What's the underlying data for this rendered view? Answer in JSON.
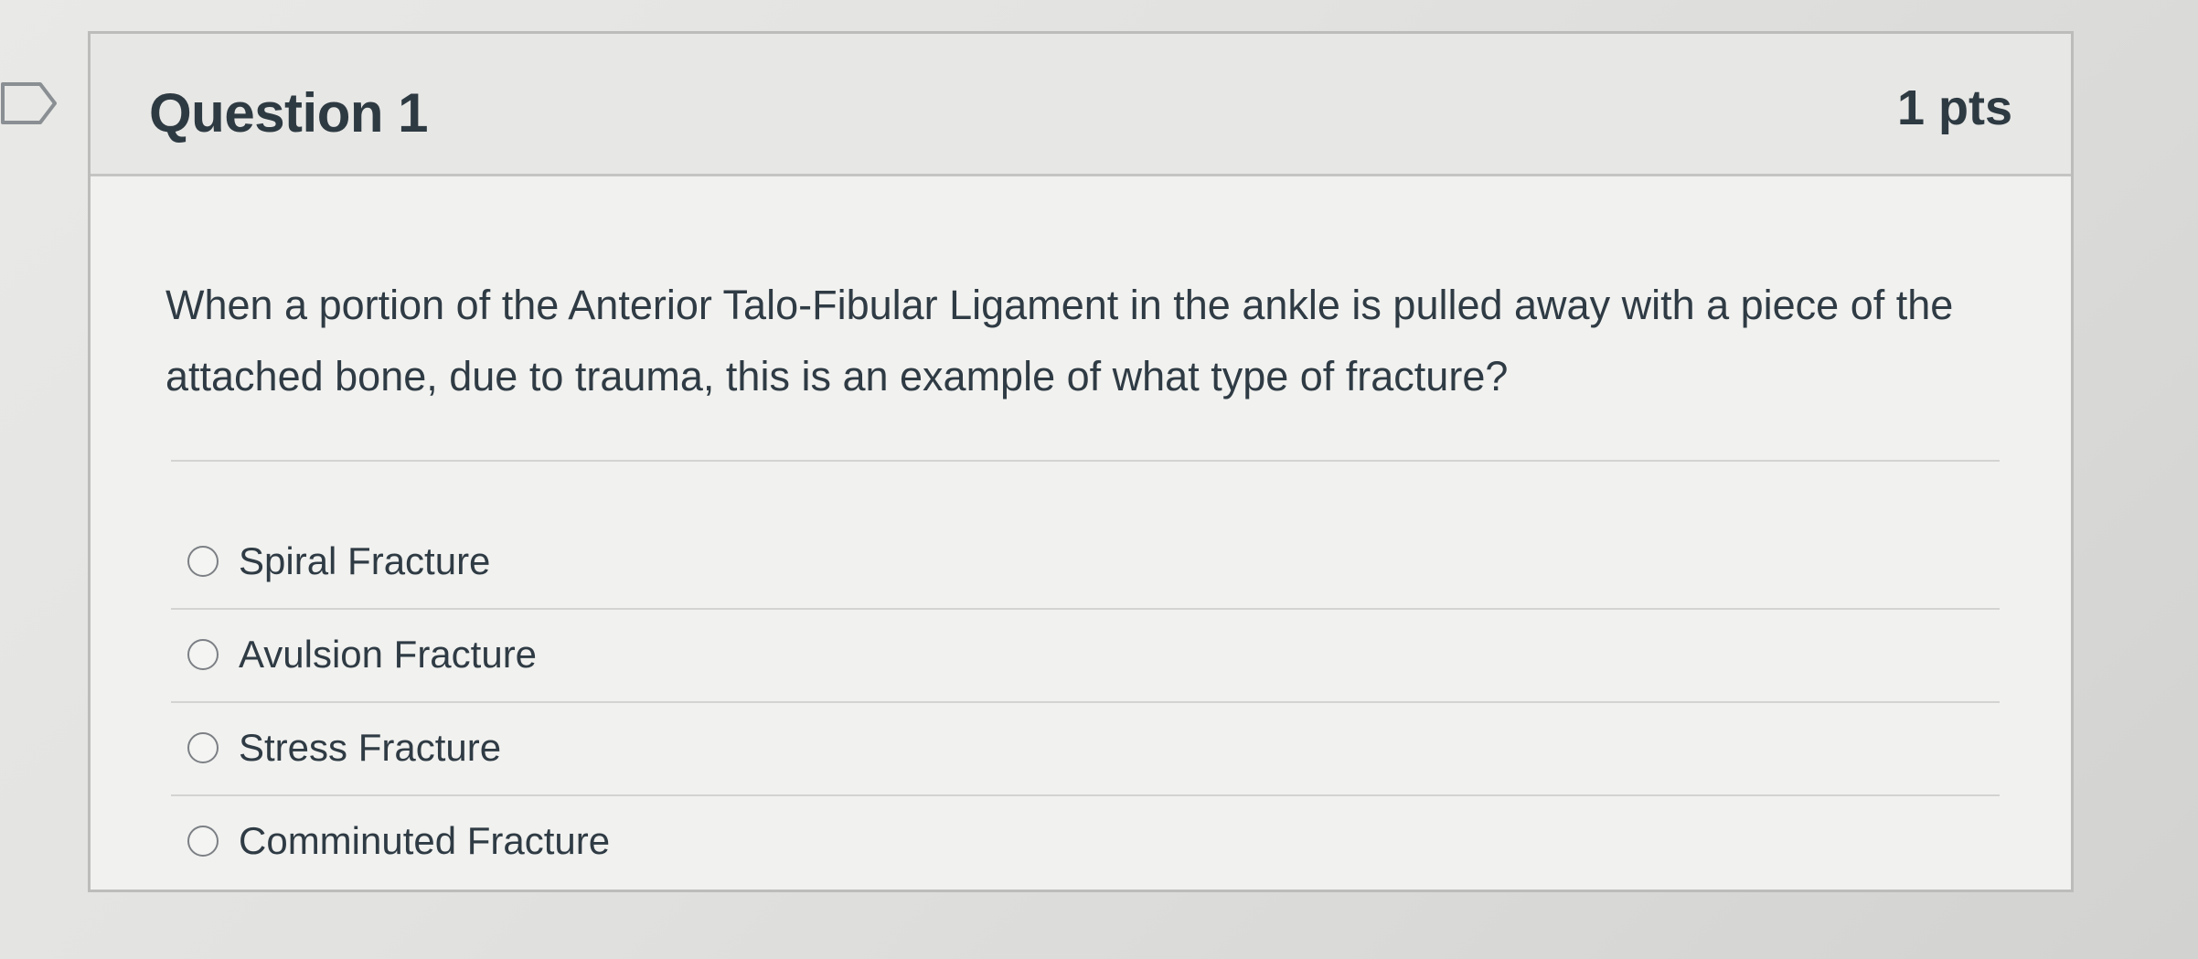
{
  "question": {
    "title": "Question 1",
    "points": "1 pts",
    "text": "When a portion of the Anterior Talo-Fibular Ligament in the ankle is pulled away with a piece of the attached bone, due to trauma, this is an example of what type of fracture?"
  },
  "answers": [
    {
      "label": "Spiral Fracture",
      "selected": false
    },
    {
      "label": "Avulsion Fracture",
      "selected": false
    },
    {
      "label": "Stress Fracture",
      "selected": false
    },
    {
      "label": "Comminuted Fracture",
      "selected": false
    }
  ],
  "icons": {
    "flag": "flag-question-icon",
    "radio": "radio-unchecked-icon"
  },
  "colors": {
    "text": "#2d3b45",
    "header_bg": "#e7e7e5",
    "card_bg": "#f1f1ef",
    "border": "#bcbcba"
  }
}
